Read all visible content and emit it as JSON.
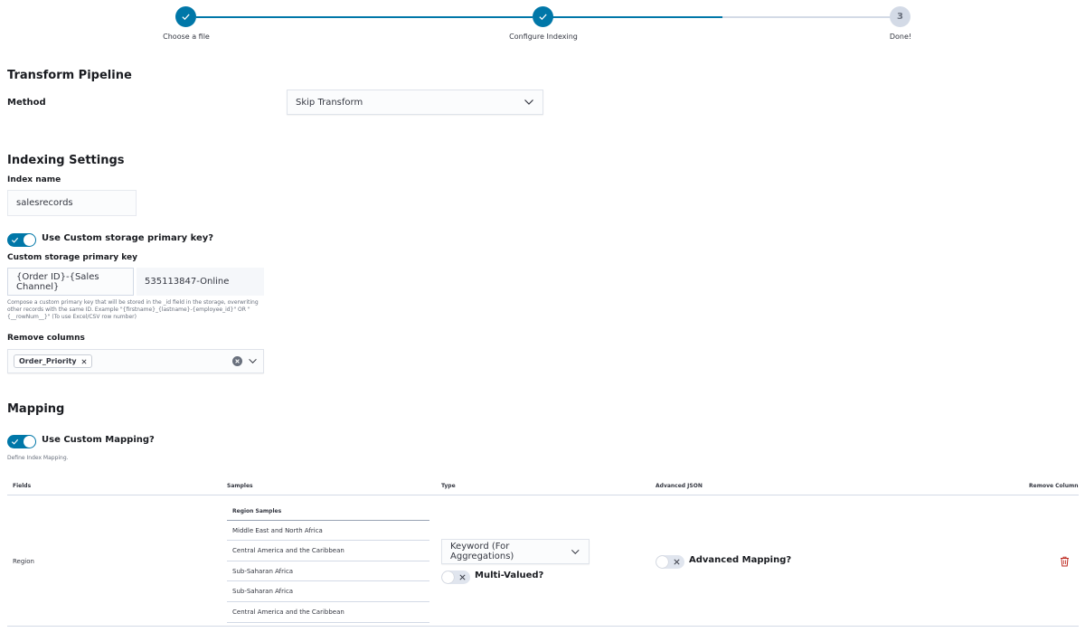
{
  "stepper": {
    "steps": [
      {
        "label": "Choose a file",
        "status": "complete"
      },
      {
        "label": "Configure Indexing",
        "status": "complete"
      },
      {
        "label": "Done!",
        "status": "incomplete",
        "number": "3"
      }
    ],
    "accent": "#0077a8"
  },
  "transform": {
    "title": "Transform Pipeline",
    "method_label": "Method",
    "method_value": "Skip Transform"
  },
  "indexing": {
    "title": "Indexing Settings",
    "index_name_label": "Index name",
    "index_name_value": "salesrecords",
    "custom_pk_toggle_label": "Use Custom storage primary key?",
    "custom_pk_toggle_on": true,
    "custom_pk_label": "Custom storage primary key",
    "custom_pk_value": "{Order ID}-{Sales Channel}",
    "custom_pk_preview": "535113847-Online",
    "custom_pk_help": "Compose a custom primary key that will be stored in the _id field in the storage, overwriting other records with the same ID. Example \"{firstname}_{lastname}-{employee_id}\" OR \"{__rowNum__}\" (To use Excel/CSV row number)",
    "remove_columns_label": "Remove columns",
    "remove_columns_selected": [
      "Order_Priority"
    ]
  },
  "mapping": {
    "title": "Mapping",
    "custom_mapping_toggle_label": "Use Custom Mapping?",
    "custom_mapping_toggle_on": true,
    "help": "Define Index Mapping.",
    "table": {
      "headers": [
        "Fields",
        "Samples",
        "Type",
        "Advanced JSON",
        "Remove Column"
      ],
      "rows": [
        {
          "field": "Region",
          "samples_header": "Region Samples",
          "samples": [
            "Middle East and North Africa",
            "Central America and the Caribbean",
            "Sub-Saharan Africa",
            "Sub-Saharan Africa",
            "Central America and the Caribbean"
          ],
          "type": "Keyword (For Aggregations)",
          "multi_valued_label": "Multi-Valued?",
          "multi_valued_on": false,
          "advanced_mapping_label": "Advanced Mapping?",
          "advanced_mapping_on": false
        }
      ]
    },
    "delete_color": "#bd271e"
  }
}
